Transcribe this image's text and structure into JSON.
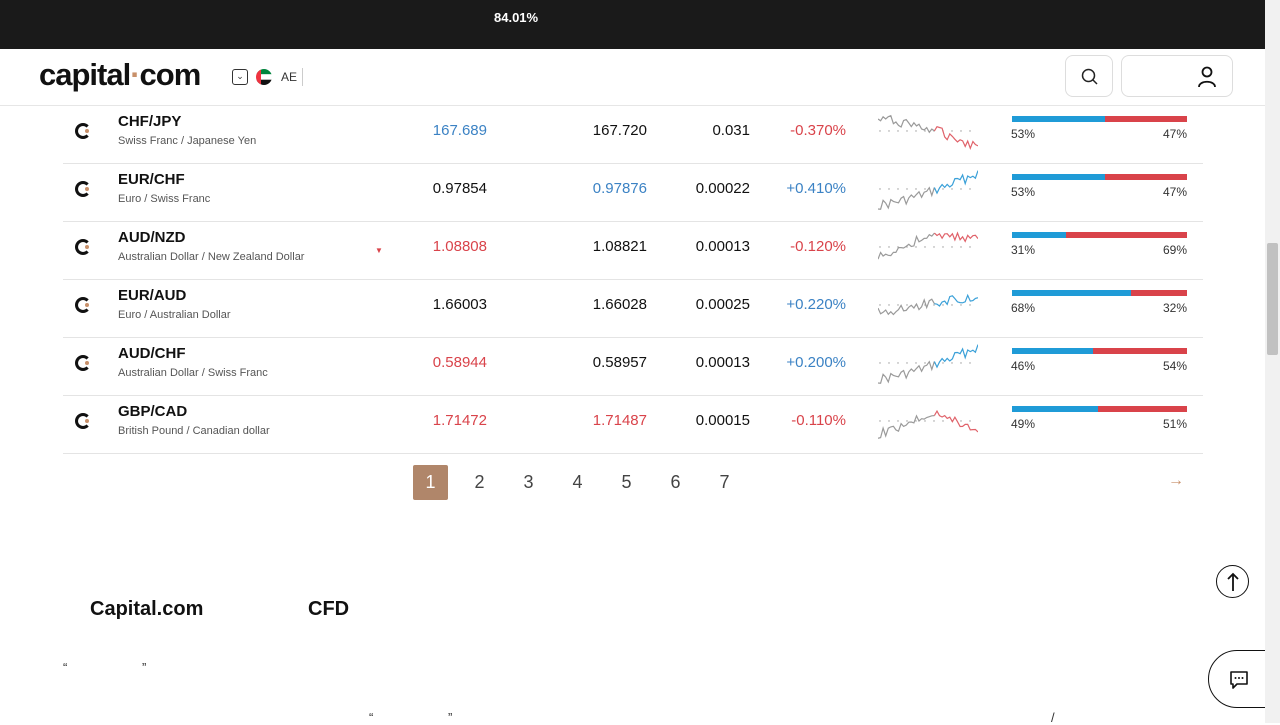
{
  "topbar": {
    "percentage": "84.01%"
  },
  "header": {
    "logo_text": "capital",
    "logo_dot": "·",
    "logo_suffix": "com",
    "lang_toggle_icon": "chevron-down-icon",
    "lang_code": "AE",
    "search_icon": "search-icon",
    "user_icon": "user-icon"
  },
  "rows": [
    {
      "pair": "CHF/JPY",
      "desc": "Swiss Franc / Japanese Yen",
      "arrow": "",
      "sell": "167.689",
      "sell_color": "blue",
      "buy": "167.720",
      "buy_color": "black",
      "spread": "0.031",
      "change": "-0.370%",
      "change_color": "red",
      "buy_pct": "53%",
      "sell_pct": "47%",
      "buy_ratio": 0.53,
      "trend": "down"
    },
    {
      "pair": "EUR/CHF",
      "desc": "Euro / Swiss Franc",
      "arrow": "",
      "sell": "0.97854",
      "sell_color": "black",
      "buy": "0.97876",
      "buy_color": "blue",
      "spread": "0.00022",
      "change": "+0.410%",
      "change_color": "blue",
      "buy_pct": "53%",
      "sell_pct": "47%",
      "buy_ratio": 0.53,
      "trend": "up"
    },
    {
      "pair": "AUD/NZD",
      "desc": "Australian Dollar / New Zealand Dollar",
      "arrow": "▼",
      "sell": "1.08808",
      "sell_color": "red",
      "buy": "1.08821",
      "buy_color": "black",
      "spread": "0.00013",
      "change": "-0.120%",
      "change_color": "red",
      "buy_pct": "31%",
      "sell_pct": "69%",
      "buy_ratio": 0.31,
      "trend": "flatdown"
    },
    {
      "pair": "EUR/AUD",
      "desc": "Euro / Australian Dollar",
      "arrow": "",
      "sell": "1.66003",
      "sell_color": "black",
      "buy": "1.66028",
      "buy_color": "black",
      "spread": "0.00025",
      "change": "+0.220%",
      "change_color": "blue",
      "buy_pct": "68%",
      "sell_pct": "32%",
      "buy_ratio": 0.68,
      "trend": "volatileup"
    },
    {
      "pair": "AUD/CHF",
      "desc": "Australian Dollar / Swiss Franc",
      "arrow": "",
      "sell": "0.58944",
      "sell_color": "red",
      "buy": "0.58957",
      "buy_color": "black",
      "spread": "0.00013",
      "change": "+0.200%",
      "change_color": "blue",
      "buy_pct": "46%",
      "sell_pct": "54%",
      "buy_ratio": 0.46,
      "trend": "up"
    },
    {
      "pair": "GBP/CAD",
      "desc": "British Pound / Canadian dollar",
      "arrow": "",
      "sell": "1.71472",
      "sell_color": "red",
      "buy": "1.71487",
      "buy_color": "red",
      "spread": "0.00015",
      "change": "-0.110%",
      "change_color": "red",
      "buy_pct": "49%",
      "sell_pct": "51%",
      "buy_ratio": 0.49,
      "trend": "spikedown"
    }
  ],
  "pagination": {
    "pages": [
      "1",
      "2",
      "3",
      "4",
      "5",
      "6",
      "7"
    ],
    "active": "1",
    "next_icon": "arrow-right-icon"
  },
  "section": {
    "brand": "Capital.com",
    "cfd": "CFD"
  },
  "quotes": {
    "q1_open": "“",
    "q1_close": "”",
    "q2_open": "“",
    "q2_close": "”",
    "slash": "/"
  },
  "floating": {
    "up_icon": "arrow-up-icon",
    "chat_icon": "chat-icon"
  },
  "colors": {
    "blue": "#1f9bd7",
    "red": "#d9434a",
    "brand": "#c8906a"
  }
}
